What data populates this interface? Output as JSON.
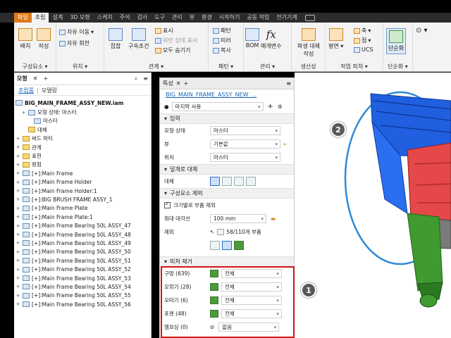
{
  "ribbon_tabs": [
    "파일",
    "조립",
    "설계",
    "3D 모형",
    "스케치",
    "주석",
    "검사",
    "도구",
    "관리",
    "뷰",
    "환경",
    "시작하기",
    "공동 작업",
    "전기기계"
  ],
  "active_tab": "조립",
  "ribbon": {
    "place": "배치",
    "create": "작성",
    "component_group": "구성요소",
    "free_move": "자유 이동",
    "free_rotate": "자유 회전",
    "position_group": "위치",
    "join": "접합",
    "constrain": "구속조건",
    "show": "표시",
    "show_sick": "위반 상태 표시",
    "hide_all": "모두 숨기기",
    "relations_group": "관계",
    "pattern": "패턴",
    "mirror": "미러",
    "copy": "복사",
    "pattern_group": "패턴",
    "bom": "BOM",
    "params": "매개변수",
    "manage_group": "관리",
    "derive_sub": "파생 대체",
    "derive_sub2": "작성",
    "productivity_group": "생산성",
    "plane": "평면",
    "axis": "축",
    "point": "점",
    "ucs": "UCS",
    "work_group": "작업 피쳐",
    "simplify": "단순화",
    "simplify_group": "단순화"
  },
  "browser": {
    "tab_model": "모형",
    "tab_assembly": "조립품",
    "tab_modeling": "모델링",
    "root": "BIG_MAIN_FRAME_ASSY_NEW.iam",
    "items": [
      "모형 상태: 마스터",
      "마스터",
      "대체",
      "써드 파티",
      "관계",
      "표현",
      "원점",
      "[+]:Main Frame",
      "[+]:Main Frame Holder",
      "[+]:Main Frame Holder:1",
      "[+]:BIG BRUSH FRAME ASSY_1",
      "[+]:Main Frame Plate",
      "[+]:Main Frame Plate:1",
      "[+]:Main Frame Bearing 50L ASSY_47",
      "[+]:Main Frame Bearing 50L ASSY_48",
      "[+]:Main Frame Bearing 50L ASSY_49",
      "[+]:Main Frame Bearing 50L ASSY_50",
      "[+]:Main Frame Bearing 50L ASSY_51",
      "[+]:Main Frame Bearing 50L ASSY_52",
      "[+]:Main Frame Bearing 50L ASSY_53",
      "[+]:Main Frame Bearing 50L ASSY_54",
      "[+]:Main Frame Bearing 50L ASSY_55",
      "[+]:Main Frame Bearing 50L ASSY_56"
    ]
  },
  "props": {
    "tab": "특성",
    "file_link": "BIG_MAIN_FRAME_ASSY_NEW_...",
    "preset": "마지막 사용",
    "input_section": "입력",
    "model_state_label": "모형 상태",
    "model_state_value": "마스터",
    "view_label": "뷰",
    "view_value": "기본값",
    "position_label": "위치",
    "position_value": "마스터",
    "envelope_section": "덮개로 대체",
    "replace_label": "대체",
    "remove_section": "구성요소 제외",
    "size_check": "크기별로 부품 제외",
    "max_diag_label": "최대 대각선",
    "max_diag_value": "100 mm",
    "exclude_label": "제외",
    "exclude_count": "58/110개 부품",
    "feature_section": "피쳐 제거",
    "holes_label": "구멍 (639)",
    "holes_value": "전체",
    "fillets_label": "모깎기 (28)",
    "fillets_value": "전체",
    "chamfers_label": "모따기 (6)",
    "chamfers_value": "전체",
    "pockets_label": "포켓 (48)",
    "pockets_value": "전체",
    "embossed_label": "엠보싱 (0)",
    "embossed_value": "없음"
  },
  "badges": {
    "one": "1",
    "two": "2"
  }
}
